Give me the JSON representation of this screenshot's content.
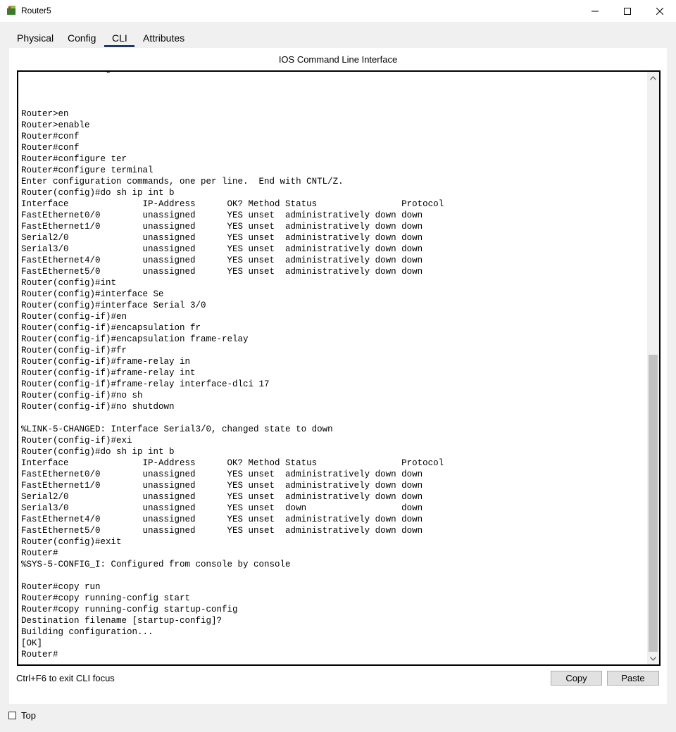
{
  "window": {
    "title": "Router5",
    "icon": "router-icon"
  },
  "tabs": [
    {
      "label": "Physical"
    },
    {
      "label": "Config"
    },
    {
      "label": "CLI",
      "active": true
    },
    {
      "label": "Attributes"
    }
  ],
  "panel": {
    "title": "IOS Command Line Interface"
  },
  "console": {
    "text": "Press RETURN to get started.\n\n\n\nRouter>en\nRouter>enable\nRouter#conf\nRouter#conf\nRouter#configure ter\nRouter#configure terminal\nEnter configuration commands, one per line.  End with CNTL/Z.\nRouter(config)#do sh ip int b\nInterface              IP-Address      OK? Method Status                Protocol\nFastEthernet0/0        unassigned      YES unset  administratively down down\nFastEthernet1/0        unassigned      YES unset  administratively down down\nSerial2/0              unassigned      YES unset  administratively down down\nSerial3/0              unassigned      YES unset  administratively down down\nFastEthernet4/0        unassigned      YES unset  administratively down down\nFastEthernet5/0        unassigned      YES unset  administratively down down\nRouter(config)#int\nRouter(config)#interface Se\nRouter(config)#interface Serial 3/0\nRouter(config-if)#en\nRouter(config-if)#encapsulation fr\nRouter(config-if)#encapsulation frame-relay\nRouter(config-if)#fr\nRouter(config-if)#frame-relay in\nRouter(config-if)#frame-relay int\nRouter(config-if)#frame-relay interface-dlci 17\nRouter(config-if)#no sh\nRouter(config-if)#no shutdown\n\n%LINK-5-CHANGED: Interface Serial3/0, changed state to down\nRouter(config-if)#exi\nRouter(config)#do sh ip int b\nInterface              IP-Address      OK? Method Status                Protocol\nFastEthernet0/0        unassigned      YES unset  administratively down down\nFastEthernet1/0        unassigned      YES unset  administratively down down\nSerial2/0              unassigned      YES unset  administratively down down\nSerial3/0              unassigned      YES unset  down                  down\nFastEthernet4/0        unassigned      YES unset  administratively down down\nFastEthernet5/0        unassigned      YES unset  administratively down down\nRouter(config)#exit\nRouter#\n%SYS-5-CONFIG_I: Configured from console by console\n\nRouter#copy run\nRouter#copy running-config start\nRouter#copy running-config startup-config\nDestination filename [startup-config]?\nBuilding configuration...\n[OK]\nRouter#"
  },
  "footer": {
    "hint": "Ctrl+F6 to exit CLI focus",
    "copy_label": "Copy",
    "paste_label": "Paste",
    "top_label": "Top",
    "top_checked": false
  }
}
